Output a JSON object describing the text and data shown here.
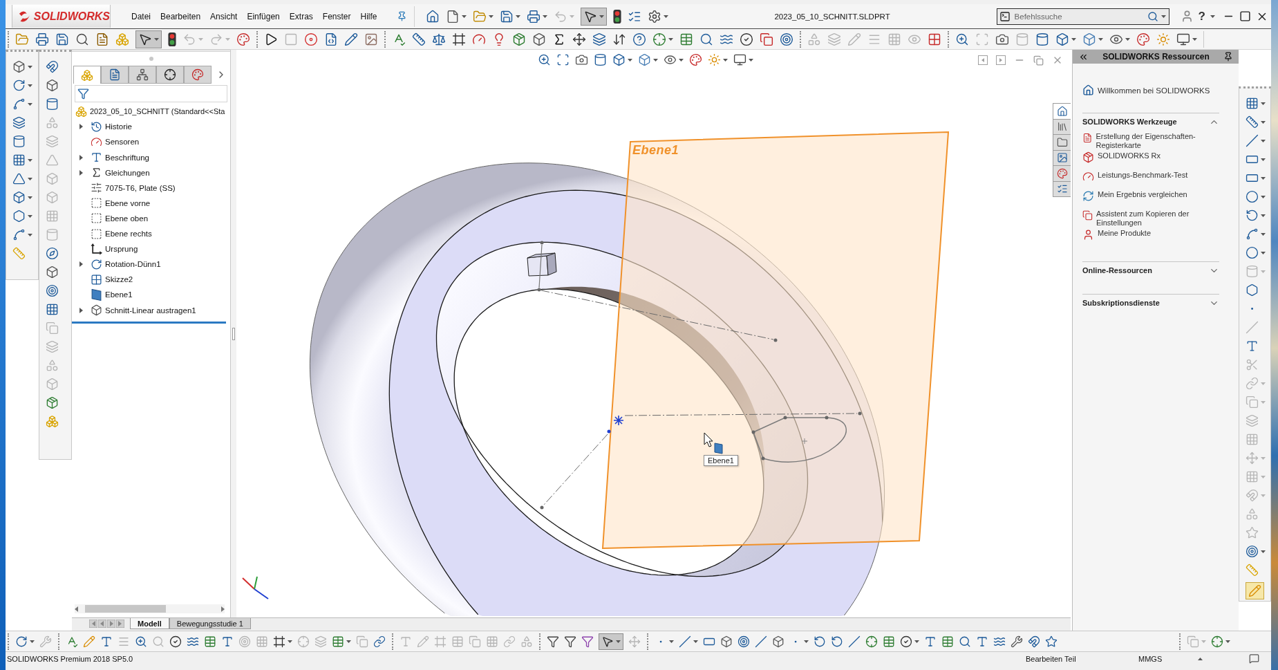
{
  "window": {
    "logo": "SOLIDWORKS",
    "menu": [
      "Datei",
      "Bearbeiten",
      "Ansicht",
      "Einfügen",
      "Extras",
      "Fenster",
      "Hilfe"
    ],
    "title": "2023_05_10_SCHNITT.SLDPRT",
    "search": {
      "placeholder": "Befehlssuche"
    },
    "help": "?"
  },
  "toolbars": {
    "quick_access": [
      {
        "kind": "home",
        "disabled": false,
        "pressed": false
      },
      {
        "kind": "new",
        "dropdown": true,
        "disabled": false,
        "pressed": false
      },
      {
        "kind": "open",
        "dropdown": true,
        "disabled": false,
        "pressed": false
      },
      {
        "kind": "save",
        "dropdown": true,
        "disabled": false,
        "pressed": false
      },
      {
        "kind": "print",
        "dropdown": true,
        "disabled": false,
        "pressed": false
      },
      {
        "kind": "undo",
        "dropdown": true,
        "disabled": true,
        "pressed": false
      },
      {
        "kind": "select",
        "dropdown": true,
        "disabled": false,
        "pressed": true
      },
      {
        "kind": "rebuild",
        "disabled": false,
        "pressed": false
      },
      {
        "kind": "options",
        "disabled": false,
        "pressed": false
      },
      {
        "kind": "settings",
        "dropdown": true,
        "disabled": false,
        "pressed": false
      }
    ],
    "standard": [
      {
        "kind": "open",
        "disabled": false,
        "pressed": false
      },
      {
        "kind": "print",
        "disabled": false,
        "pressed": false
      },
      {
        "kind": "save",
        "disabled": false,
        "pressed": false
      },
      {
        "kind": "preview",
        "disabled": false,
        "pressed": false
      },
      {
        "kind": "fileprops",
        "disabled": false,
        "pressed": false
      },
      {
        "kind": "pack",
        "disabled": false,
        "pressed": false
      },
      {
        "kind": "select",
        "dropdown": true,
        "disabled": false,
        "pressed": true
      },
      {
        "kind": "rebuild",
        "disabled": false,
        "pressed": false
      },
      {
        "kind": "undo",
        "dropdown": true,
        "disabled": true,
        "pressed": false
      },
      {
        "kind": "redo",
        "dropdown": true,
        "disabled": true,
        "pressed": false
      },
      {
        "kind": "appearance",
        "disabled": false,
        "pressed": false
      }
    ],
    "macro": [
      {
        "kind": "play",
        "disabled": false
      },
      {
        "kind": "stop",
        "disabled": true
      },
      {
        "kind": "record",
        "disabled": false
      },
      {
        "kind": "macro_new",
        "disabled": false
      },
      {
        "kind": "macro_edit",
        "disabled": false
      },
      {
        "kind": "macro_img",
        "disabled": false
      }
    ],
    "tools": [
      {
        "kind": "spell"
      },
      {
        "kind": "measure"
      },
      {
        "kind": "mass"
      },
      {
        "kind": "frame"
      },
      {
        "kind": "gauge"
      },
      {
        "kind": "evaluate"
      },
      {
        "kind": "cubecheck"
      },
      {
        "kind": "cube"
      },
      {
        "kind": "sigma"
      },
      {
        "kind": "move"
      },
      {
        "kind": "layers"
      },
      {
        "kind": "compress"
      },
      {
        "kind": "help"
      },
      {
        "kind": "crosshair",
        "dropdown": true
      },
      {
        "kind": "table"
      },
      {
        "kind": "search"
      },
      {
        "kind": "waves"
      },
      {
        "kind": "check"
      },
      {
        "kind": "copy"
      },
      {
        "kind": "target"
      }
    ],
    "curvature": [
      {
        "kind": "shapes",
        "disabled": true
      },
      {
        "kind": "layers",
        "disabled": true
      },
      {
        "kind": "pencil",
        "disabled": true
      },
      {
        "kind": "menu",
        "disabled": true
      },
      {
        "kind": "grid",
        "disabled": true
      },
      {
        "kind": "eye",
        "disabled": true
      },
      {
        "kind": "colorbar",
        "disabled": false
      }
    ],
    "view": [
      {
        "kind": "zoom",
        "disabled": false
      },
      {
        "kind": "zoomarea",
        "disabled": true
      },
      {
        "kind": "prev",
        "disabled": false
      },
      {
        "kind": "section",
        "disabled": true
      },
      {
        "kind": "section",
        "disabled": false
      },
      {
        "kind": "orient",
        "dropdown": true,
        "disabled": false
      },
      {
        "kind": "display",
        "dropdown": true,
        "disabled": false
      },
      {
        "kind": "hide",
        "dropdown": true,
        "disabled": false
      },
      {
        "kind": "appearance",
        "disabled": false
      },
      {
        "kind": "scene",
        "disabled": false
      },
      {
        "kind": "monitor",
        "dropdown": true,
        "disabled": false
      }
    ],
    "features": [
      {
        "kind": "cube",
        "dropdown": true
      },
      {
        "kind": "revolve",
        "dropdown": true
      },
      {
        "kind": "sweep",
        "dropdown": true
      },
      {
        "kind": "layers"
      },
      {
        "kind": "fillet"
      },
      {
        "kind": "pattern",
        "dropdown": true
      },
      {
        "kind": "rib",
        "dropdown": true
      },
      {
        "kind": "shell",
        "dropdown": true
      },
      {
        "kind": "refgeom",
        "dropdown": true
      },
      {
        "kind": "sweep",
        "dropdown": true
      },
      {
        "kind": "instant"
      }
    ],
    "sketch_left": [
      {
        "kind": "magnet",
        "disabled": false
      },
      {
        "kind": "cube",
        "disabled": false
      },
      {
        "kind": "section",
        "disabled": false
      },
      {
        "kind": "shapes",
        "disabled": true
      },
      {
        "kind": "layers",
        "disabled": true
      },
      {
        "kind": "rib",
        "disabled": true
      },
      {
        "kind": "cube",
        "disabled": true
      },
      {
        "kind": "shell",
        "disabled": true
      },
      {
        "kind": "pattern",
        "disabled": true
      },
      {
        "kind": "fillet",
        "disabled": true
      },
      {
        "kind": "compass",
        "disabled": false
      },
      {
        "kind": "cube",
        "disabled": false
      },
      {
        "kind": "target",
        "disabled": false
      },
      {
        "kind": "grid",
        "disabled": false
      },
      {
        "kind": "copy",
        "disabled": true
      },
      {
        "kind": "layers",
        "disabled": true
      },
      {
        "kind": "shapes",
        "disabled": true
      },
      {
        "kind": "cube",
        "disabled": true
      },
      {
        "kind": "cubecheck",
        "disabled": false
      },
      {
        "kind": "pack",
        "disabled": false
      }
    ],
    "sketch": [
      {
        "kind": "grid",
        "dropdown": true,
        "disabled": false,
        "pressed": false
      },
      {
        "kind": "measure",
        "dropdown": true,
        "disabled": false,
        "pressed": false
      },
      {
        "kind": "line",
        "dropdown": true,
        "disabled": false,
        "pressed": false
      },
      {
        "kind": "rect",
        "dropdown": true,
        "disabled": false,
        "pressed": false
      },
      {
        "kind": "rect",
        "dropdown": true,
        "disabled": false,
        "pressed": false
      },
      {
        "kind": "circle",
        "dropdown": true,
        "disabled": false,
        "pressed": false
      },
      {
        "kind": "arc",
        "dropdown": true,
        "disabled": false,
        "pressed": false
      },
      {
        "kind": "sweep",
        "dropdown": true,
        "disabled": false,
        "pressed": false
      },
      {
        "kind": "circle",
        "dropdown": true,
        "disabled": false,
        "pressed": false
      },
      {
        "kind": "fillet",
        "dropdown": true,
        "disabled": true,
        "pressed": false
      },
      {
        "kind": "polygon",
        "disabled": false,
        "pressed": false
      },
      {
        "kind": "point",
        "disabled": false,
        "pressed": false
      },
      {
        "kind": "line",
        "disabled": true,
        "pressed": false
      },
      {
        "kind": "text",
        "disabled": false,
        "pressed": false
      },
      {
        "kind": "trim",
        "disabled": true,
        "pressed": false
      },
      {
        "kind": "link",
        "dropdown": true,
        "disabled": true,
        "pressed": false
      },
      {
        "kind": "copy",
        "dropdown": true,
        "disabled": true,
        "pressed": false
      },
      {
        "kind": "layers",
        "disabled": true,
        "pressed": false
      },
      {
        "kind": "grid",
        "disabled": true,
        "pressed": false
      },
      {
        "kind": "move",
        "dropdown": true,
        "disabled": true,
        "pressed": false
      },
      {
        "kind": "pattern",
        "dropdown": true,
        "disabled": true,
        "pressed": false
      },
      {
        "kind": "magnet",
        "dropdown": true,
        "disabled": true,
        "pressed": false
      },
      {
        "kind": "shapes",
        "disabled": true,
        "pressed": false
      },
      {
        "kind": "star",
        "disabled": true,
        "pressed": false
      },
      {
        "kind": "target",
        "dropdown": true,
        "disabled": false,
        "pressed": false
      },
      {
        "kind": "instant",
        "disabled": false,
        "pressed": false
      },
      {
        "kind": "sketch",
        "disabled": false,
        "pressed": true
      }
    ],
    "bottom_a": [
      {
        "kind": "revolve",
        "dropdown": true,
        "disabled": false
      },
      {
        "kind": "wrench",
        "disabled": true
      }
    ],
    "bottom_b": [
      {
        "kind": "spell",
        "disabled": false
      },
      {
        "kind": "sketch",
        "disabled": false
      },
      {
        "kind": "text",
        "disabled": false
      },
      {
        "kind": "menu",
        "disabled": true
      },
      {
        "kind": "zoom",
        "disabled": false
      },
      {
        "kind": "search",
        "disabled": true
      },
      {
        "kind": "check",
        "disabled": false
      },
      {
        "kind": "waves",
        "disabled": false
      },
      {
        "kind": "table",
        "disabled": false
      },
      {
        "kind": "text",
        "disabled": false
      },
      {
        "kind": "target",
        "disabled": true
      },
      {
        "kind": "grid",
        "disabled": true
      },
      {
        "kind": "frame",
        "dropdown": true,
        "disabled": false
      },
      {
        "kind": "crosshair",
        "disabled": true
      },
      {
        "kind": "layers",
        "disabled": true
      },
      {
        "kind": "table",
        "dropdown": true,
        "disabled": false
      },
      {
        "kind": "copy",
        "disabled": true
      },
      {
        "kind": "link",
        "disabled": false
      }
    ],
    "bottom_c": [
      {
        "kind": "text",
        "disabled": true
      },
      {
        "kind": "pencil",
        "disabled": true
      },
      {
        "kind": "frame",
        "disabled": true
      },
      {
        "kind": "table",
        "disabled": true
      },
      {
        "kind": "copy",
        "disabled": true
      },
      {
        "kind": "grid",
        "disabled": true
      },
      {
        "kind": "link",
        "disabled": true
      },
      {
        "kind": "shapes",
        "disabled": true
      }
    ],
    "bottom_d": [
      {
        "kind": "filter",
        "disabled": false,
        "pressed": false
      },
      {
        "kind": "filter",
        "disabled": false,
        "pressed": false
      },
      {
        "kind": "filter2",
        "disabled": false,
        "pressed": false
      },
      {
        "kind": "select",
        "dropdown": true,
        "disabled": false,
        "pressed": true
      },
      {
        "kind": "move",
        "disabled": true,
        "pressed": false
      }
    ],
    "bottom_e": [
      {
        "kind": "point",
        "dropdown": true
      },
      {
        "kind": "line",
        "dropdown": true
      },
      {
        "kind": "rect"
      },
      {
        "kind": "cube"
      },
      {
        "kind": "target"
      },
      {
        "kind": "line"
      },
      {
        "kind": "cube"
      },
      {
        "kind": "point",
        "dropdown": true
      },
      {
        "kind": "arc"
      },
      {
        "kind": "arc"
      },
      {
        "kind": "line"
      },
      {
        "kind": "crosshair"
      },
      {
        "kind": "table"
      },
      {
        "kind": "check",
        "dropdown": true
      },
      {
        "kind": "text"
      },
      {
        "kind": "table"
      },
      {
        "kind": "search"
      },
      {
        "kind": "text"
      },
      {
        "kind": "waves"
      },
      {
        "kind": "wrench"
      },
      {
        "kind": "magnet"
      },
      {
        "kind": "star"
      }
    ],
    "bottom_f": [
      {
        "kind": "copy",
        "dropdown": true,
        "disabled": true
      },
      {
        "kind": "crosshair",
        "dropdown": true,
        "disabled": false
      }
    ]
  },
  "feature_manager": {
    "tabs": [
      {
        "kind": "features",
        "selected": true
      },
      {
        "kind": "properties",
        "selected": false
      },
      {
        "kind": "config",
        "selected": false
      },
      {
        "kind": "dimxpert",
        "selected": false
      },
      {
        "kind": "appearance",
        "selected": false
      }
    ],
    "root": {
      "label": "2023_05_10_SCHNITT (Standard<<Sta",
      "kind": "features"
    },
    "items": [
      {
        "label": "Historie",
        "kind": "history",
        "expanded": false
      },
      {
        "label": "Sensoren",
        "kind": "sensor"
      },
      {
        "label": "Beschriftung",
        "kind": "annotation",
        "expanded": false
      },
      {
        "label": "Gleichungen",
        "kind": "equation",
        "expanded": false
      },
      {
        "label": "7075-T6, Plate (SS)",
        "kind": "material"
      },
      {
        "label": "Ebene vorne",
        "kind": "plane"
      },
      {
        "label": "Ebene oben",
        "kind": "plane"
      },
      {
        "label": "Ebene rechts",
        "kind": "plane"
      },
      {
        "label": "Ursprung",
        "kind": "origin"
      },
      {
        "label": "Rotation-Dünn1",
        "kind": "revolve",
        "expanded": false
      },
      {
        "label": "Skizze2",
        "kind": "sketchgrid"
      },
      {
        "label": "Ebene1",
        "kind": "refplane"
      },
      {
        "label": "Schnitt-Linear austragen1",
        "kind": "cut",
        "expanded": false
      }
    ]
  },
  "viewport": {
    "heads_up": [
      {
        "kind": "zoom"
      },
      {
        "kind": "zoomarea"
      },
      {
        "kind": "prev"
      },
      {
        "kind": "section"
      },
      {
        "kind": "orient",
        "dropdown": true
      },
      {
        "kind": "display",
        "dropdown": true
      },
      {
        "kind": "hide",
        "dropdown": true
      },
      {
        "kind": "appearance"
      },
      {
        "kind": "scene",
        "dropdown": true
      },
      {
        "kind": "monitor",
        "dropdown": true
      }
    ],
    "plane_label": "Ebene1",
    "tooltip": "Ebene1"
  },
  "task_tabs": [
    {
      "kind": "home",
      "selected": true
    },
    {
      "kind": "library",
      "selected": false
    },
    {
      "kind": "folder",
      "selected": false
    },
    {
      "kind": "image",
      "selected": false
    },
    {
      "kind": "appearance",
      "selected": false
    },
    {
      "kind": "options",
      "selected": false
    }
  ],
  "resources": {
    "title": "SOLIDWORKS Ressourcen",
    "welcome": "Willkommen bei SOLIDWORKS",
    "sections": [
      {
        "title": "SOLIDWORKS Werkzeuge",
        "expanded": true,
        "items": [
          {
            "label": "Erstellung der Eigenschaften-Registerkarte",
            "kind": "property_tab"
          },
          {
            "label": "SOLIDWORKS Rx",
            "kind": "rx"
          },
          {
            "label": "Leistungs-Benchmark-Test",
            "kind": "benchmark"
          },
          {
            "label": "Mein Ergebnis vergleichen",
            "kind": "compare"
          },
          {
            "label": "Assistent zum Kopieren der Einstellungen",
            "kind": "copy_settings"
          },
          {
            "label": "Meine Produkte",
            "kind": "products"
          }
        ]
      },
      {
        "title": "Online-Ressourcen",
        "expanded": false
      },
      {
        "title": "Subskriptionsdienste",
        "expanded": false
      }
    ]
  },
  "bottom_tabs": [
    {
      "label": "Modell",
      "selected": true
    },
    {
      "label": "Bewegungsstudie 1",
      "selected": false
    }
  ],
  "status_bar": {
    "product": "SOLIDWORKS Premium 2018 SP5.0",
    "mode": "Bearbeiten Teil",
    "units": "MMGS"
  }
}
